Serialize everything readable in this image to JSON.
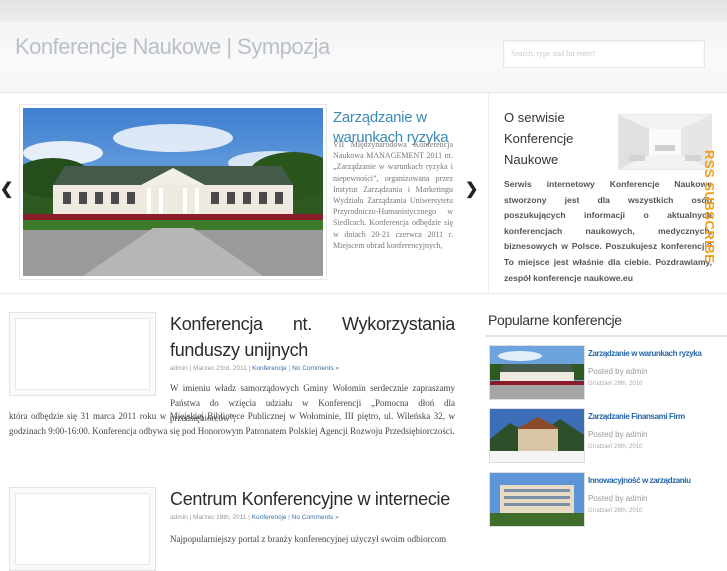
{
  "header": {
    "site_title": "Konferencje Naukowe | Sympozja",
    "search_placeholder": "Search, type and hit enter!"
  },
  "slider": {
    "title": "Zarządzanie w warunkach ryzyka",
    "text": "VII Międzynarodowa Konferencja Naukowa MANAGEMENT 2011 nt. „Zarządzanie w warunkach ryzyka i niepewności”, organizowana przez Instytut Zarządzania i Marketingu Wydziału Zarządzania Uniwersytetu Przyrodniczo-Humanistycznego w Siedlcach. Konferencja odbędzie się w dniach 20-21 czerwca 2011 r. Miejscem obrad konferencyjnych,",
    "prev_arrow": "❮",
    "next_arrow": "❯"
  },
  "about": {
    "title": "O serwisie Konferencje Naukowe",
    "text": "Serwis internetowy Konferencje Naukowe stworzony jest dla wszystkich osób poszukujących informacji o aktualnych konferencjach naukowych, medycznych, biznesowych w Polsce. Poszukujesz konferencji? To miejsce jest właśnie dla ciebie. Pozdrawiamy, zespół konferencje naukowe.eu"
  },
  "rss": {
    "label": "RSS SUBSCRIBE"
  },
  "posts": [
    {
      "title": "Konferencja nt. Wykorzystania funduszy unijnych",
      "author": "admin",
      "date": "Marzec 23rd, 2011",
      "category": "Konferencje",
      "comments": "No Comments »",
      "body_intro": "W imieniu władz samorządowych Gminy Wołomin serdecznie zapraszamy Państwa do wzięcia udziału w Konferencji „Pomocna dłoń dla przedsiębiorców”,",
      "body_rest": "która odbędzie się 31 marca 2011 roku w Miejskiej Bibliotece Publicznej w Wołominie, III piętro, ul. Wileńska 32, w godzinach 9:00-16:00. Konferencja odbywa się pod Honorowym Patronatem Polskiej Agencji Rozwoju Przedsiębiorczości."
    },
    {
      "title": "Centrum Konferencyjne w internecie",
      "author": "admin",
      "date": "Marzec 18th, 2011",
      "category": "Konferencje",
      "comments": "No Comments »",
      "body_intro": "Najpopularniejszy portal z branży konferencyjnej użyczył swoim odbiorcom"
    }
  ],
  "sidebar": {
    "title": "Popularne konferencje",
    "items": [
      {
        "title": "Zarządzanie w warunkach ryzyka",
        "posted_by": "Posted by admin",
        "date": "Grudzień 29th, 2010"
      },
      {
        "title": "Zarządzanie Finansami Firm",
        "posted_by": "Posted by admin",
        "date": "Grudzień 29th, 2010"
      },
      {
        "title": "Innowacyjność w zarządzaniu",
        "posted_by": "Posted by admin",
        "date": "Grudzień 28th, 2010"
      }
    ]
  },
  "colors": {
    "link_blue": "#3a8bb8",
    "sidebar_link": "#2565a8",
    "rss_orange": "#f39c12",
    "title_gray": "#b9c0c8"
  }
}
